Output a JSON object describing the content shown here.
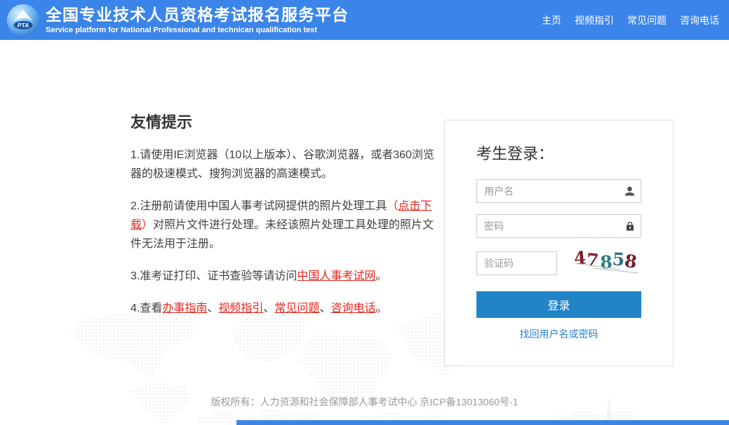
{
  "colors": {
    "header_bg": "#3b85ea",
    "button_bg": "#2184c6",
    "red_link": "#e8251d",
    "blue_link": "#2a7fd0",
    "body_text": "#404040",
    "muted_text": "#999999"
  },
  "header": {
    "logo_text": "PTA",
    "title": "全国专业技术人员资格考试报名服务平台",
    "subtitle": "Service platform for National Professional and technican qualification test",
    "nav": [
      {
        "label": "主页"
      },
      {
        "label": "视频指引"
      },
      {
        "label": "常见问题"
      },
      {
        "label": "咨询电话"
      }
    ]
  },
  "tips": {
    "heading": "友情提示",
    "tip1": {
      "text": "1.请使用IE浏览器（10以上版本）、谷歌浏览器，或者360浏览器的极速模式、搜狗浏览器的高速模式。"
    },
    "tip2": {
      "pre": "2.注册前请使用中国人事考试网提供的照片处理工具",
      "paren_open": "（",
      "link": "点击下载",
      "paren_close": "）",
      "post": "对照片文件进行处理。未经该照片处理工具处理的照片文件无法用于注册。"
    },
    "tip3": {
      "pre": "3.准考证打印、证书查验等请访问",
      "link": "中国人事考试网",
      "end": "。"
    },
    "tip4": {
      "pre": "4.查看",
      "link1": "办事指南",
      "link2": "视频指引",
      "link3": "常见问题",
      "link4": "咨询电话",
      "separator": "、",
      "end": "。"
    }
  },
  "login": {
    "heading": "考生登录：",
    "username_placeholder": "用户名",
    "password_placeholder": "密码",
    "captcha_placeholder": "验证码",
    "captcha_code": "47858",
    "captcha_digits": [
      {
        "char": "4",
        "color": "#7d2230"
      },
      {
        "char": "7",
        "color": "#7c2a33"
      },
      {
        "char": "8",
        "color": "#2a7d85"
      },
      {
        "char": "5",
        "color": "#2f6f86"
      },
      {
        "char": "8",
        "color": "#6e1f2f"
      }
    ],
    "button_label": "登录",
    "forgot_link": "找回用户名或密码"
  },
  "footer": {
    "copyright": "版权所有：人力资源和社会保障部人事考试中心 京ICP备13013060号-1"
  }
}
